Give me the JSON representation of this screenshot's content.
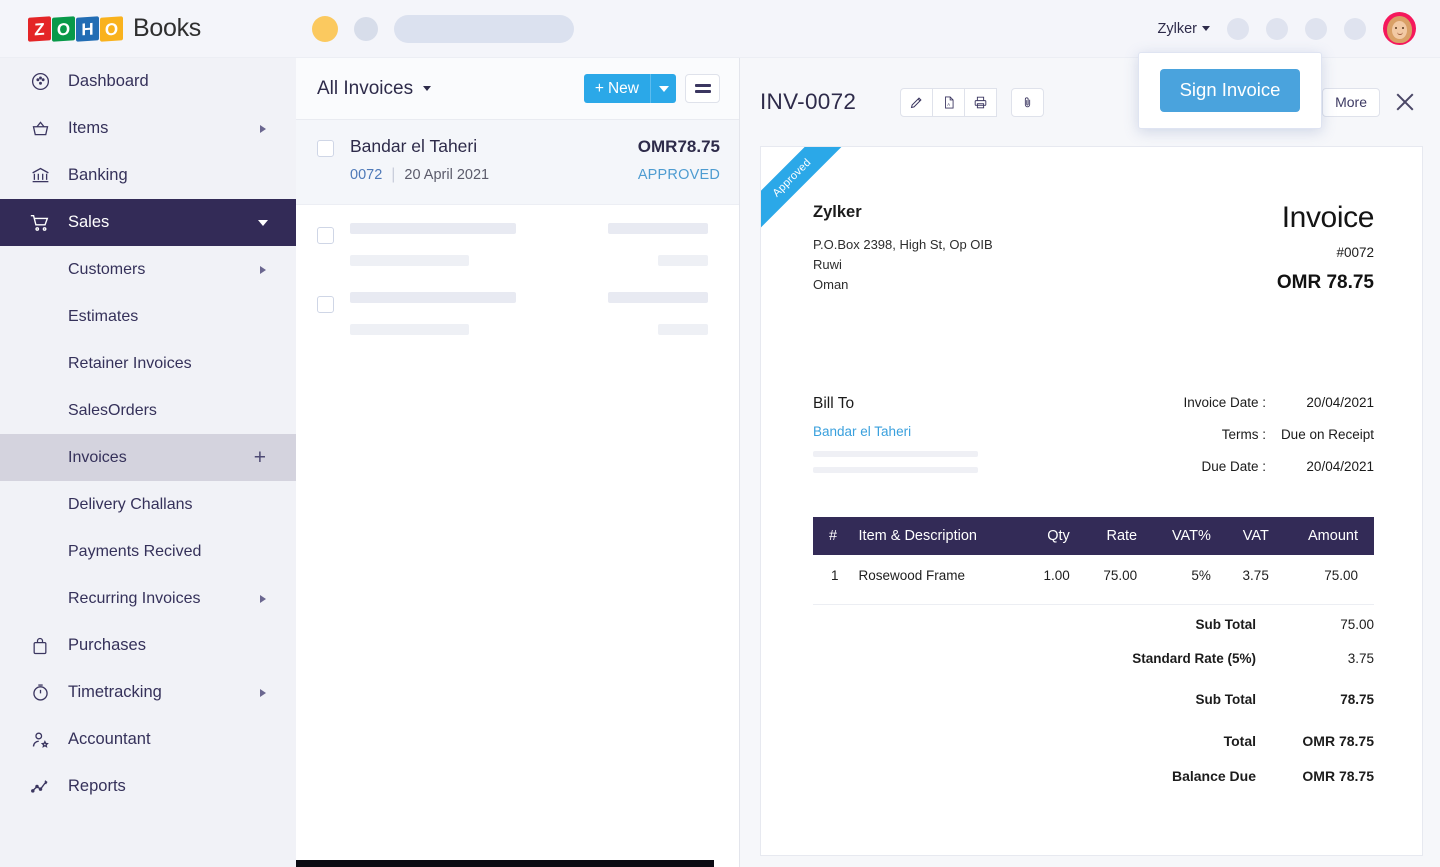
{
  "topbar": {
    "logo": {
      "blocks": [
        "Z",
        "O",
        "H",
        "O"
      ],
      "product": "Books"
    },
    "org_name": "Zylker",
    "placeholder_dots": 4
  },
  "sidebar": {
    "items": [
      {
        "label": "Dashboard",
        "icon": "dashboard-icon",
        "state": "normal",
        "level": "top",
        "trailing": "none"
      },
      {
        "label": "Items",
        "icon": "items-icon",
        "state": "normal",
        "level": "top",
        "trailing": "arrow-right"
      },
      {
        "label": "Banking",
        "icon": "bank-icon",
        "state": "normal",
        "level": "top",
        "trailing": "none"
      },
      {
        "label": "Sales",
        "icon": "cart-icon",
        "state": "active",
        "level": "top",
        "trailing": "arrow-down"
      },
      {
        "label": "Customers",
        "icon": "none",
        "state": "normal",
        "level": "sub",
        "trailing": "arrow-right"
      },
      {
        "label": "Estimates",
        "icon": "none",
        "state": "normal",
        "level": "sub",
        "trailing": "none"
      },
      {
        "label": "Retainer Invoices",
        "icon": "none",
        "state": "normal",
        "level": "sub",
        "trailing": "none"
      },
      {
        "label": "SalesOrders",
        "icon": "none",
        "state": "normal",
        "level": "sub",
        "trailing": "none"
      },
      {
        "label": "Invoices",
        "icon": "none",
        "state": "selected",
        "level": "sub",
        "trailing": "plus"
      },
      {
        "label": "Delivery Challans",
        "icon": "none",
        "state": "normal",
        "level": "sub",
        "trailing": "none"
      },
      {
        "label": "Payments Recived",
        "icon": "none",
        "state": "normal",
        "level": "sub",
        "trailing": "none"
      },
      {
        "label": "Recurring Invoices",
        "icon": "none",
        "state": "normal",
        "level": "sub",
        "trailing": "arrow-right"
      },
      {
        "label": "Purchases",
        "icon": "bag-icon",
        "state": "normal",
        "level": "top",
        "trailing": "none"
      },
      {
        "label": "Timetracking",
        "icon": "timer-icon",
        "state": "normal",
        "level": "top",
        "trailing": "arrow-right"
      },
      {
        "label": "Accountant",
        "icon": "accountant-icon",
        "state": "normal",
        "level": "top",
        "trailing": "none"
      },
      {
        "label": "Reports",
        "icon": "reports-icon",
        "state": "normal",
        "level": "top",
        "trailing": "none"
      }
    ]
  },
  "list_panel": {
    "filter_label": "All Invoices",
    "new_button": "New",
    "rows": [
      {
        "customer": "Bandar el Taheri",
        "amount": "OMR78.75",
        "number": "0072",
        "date": "20 April 2021",
        "status": "APPROVED",
        "selected": true
      }
    ],
    "skeleton_rows": 2
  },
  "detail": {
    "title": "INV-0072",
    "toolbar_icons": [
      "edit-pencil-icon",
      "pdf-icon",
      "print-icon",
      "attachment-icon"
    ],
    "more_label": "More",
    "sign_popup": {
      "button_label": "Sign Invoice"
    }
  },
  "invoice": {
    "ribbon": "Approved",
    "org": {
      "name": "Zylker",
      "address_lines": [
        "P.O.Box 2398, High St, Op OIB",
        "Ruwi",
        "Oman"
      ]
    },
    "heading": "Invoice",
    "number": "#0072",
    "amount_header": "OMR 78.75",
    "bill_to": {
      "label": "Bill To",
      "name": "Bandar el Taheri"
    },
    "meta": [
      {
        "label": "Invoice Date :",
        "value": "20/04/2021"
      },
      {
        "label": "Terms :",
        "value": "Due on Receipt"
      },
      {
        "label": "Due Date :",
        "value": "20/04/2021"
      }
    ],
    "table": {
      "columns": [
        "#",
        "Item & Description",
        "Qty",
        "Rate",
        "VAT%",
        "VAT",
        "Amount"
      ],
      "rows": [
        {
          "idx": "1",
          "description": "Rosewood Frame",
          "qty": "1.00",
          "rate": "75.00",
          "vat_pct": "5%",
          "vat": "3.75",
          "amount": "75.00"
        }
      ]
    },
    "totals": [
      {
        "label": "Sub Total",
        "value": "75.00"
      },
      {
        "label": "Standard Rate (5%)",
        "value": "3.75"
      },
      {
        "label": "Sub Total",
        "value": "78.75"
      },
      {
        "label": "Total",
        "value": "OMR 78.75"
      },
      {
        "label": "Balance Due",
        "value": "OMR 78.75"
      }
    ]
  },
  "colors": {
    "brand_navy": "#332b57",
    "accent_blue": "#2ba8e8",
    "sign_button": "#4aa3dd",
    "status_blue": "#4e9cd1",
    "sidebar_bg": "#f1f2f7"
  }
}
